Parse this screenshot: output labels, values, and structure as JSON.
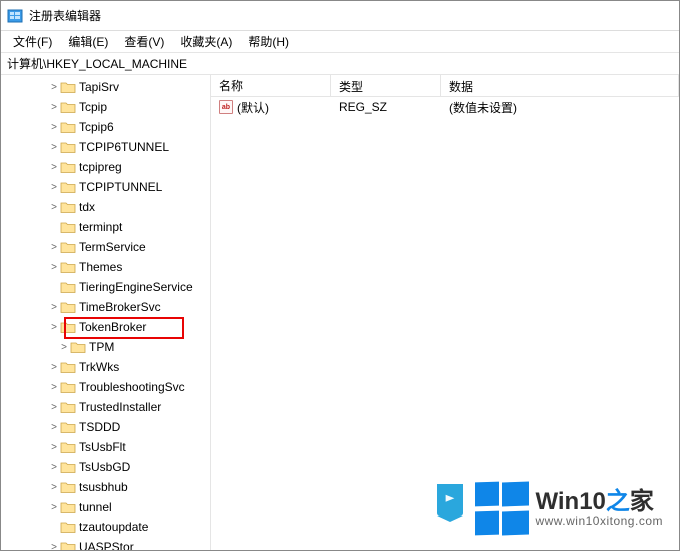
{
  "window": {
    "title": "注册表编辑器"
  },
  "menu": {
    "file": "文件(F)",
    "edit": "编辑(E)",
    "view": "查看(V)",
    "favorites": "收藏夹(A)",
    "help": "帮助(H)"
  },
  "address": {
    "path": "计算机\\HKEY_LOCAL_MACHINE"
  },
  "list": {
    "columns": {
      "name": "名称",
      "type": "类型",
      "data": "数据"
    },
    "rows": [
      {
        "name": "(默认)",
        "type": "REG_SZ",
        "data": "(数值未设置)"
      }
    ]
  },
  "tree": {
    "items": [
      {
        "label": "TapiSrv",
        "expander": ">",
        "indent": 1
      },
      {
        "label": "Tcpip",
        "expander": ">",
        "indent": 1
      },
      {
        "label": "Tcpip6",
        "expander": ">",
        "indent": 1
      },
      {
        "label": "TCPIP6TUNNEL",
        "expander": ">",
        "indent": 1
      },
      {
        "label": "tcpipreg",
        "expander": ">",
        "indent": 1
      },
      {
        "label": "TCPIPTUNNEL",
        "expander": ">",
        "indent": 1
      },
      {
        "label": "tdx",
        "expander": ">",
        "indent": 1
      },
      {
        "label": "terminpt",
        "expander": "",
        "indent": 1
      },
      {
        "label": "TermService",
        "expander": ">",
        "indent": 1
      },
      {
        "label": "Themes",
        "expander": ">",
        "indent": 1
      },
      {
        "label": "TieringEngineService",
        "expander": "",
        "indent": 1
      },
      {
        "label": "TimeBrokerSvc",
        "expander": ">",
        "indent": 1
      },
      {
        "label": "TokenBroker",
        "expander": ">",
        "indent": 1,
        "highlighted": true
      },
      {
        "label": "TPM",
        "expander": ">",
        "indent": 2
      },
      {
        "label": "TrkWks",
        "expander": ">",
        "indent": 1
      },
      {
        "label": "TroubleshootingSvc",
        "expander": ">",
        "indent": 1
      },
      {
        "label": "TrustedInstaller",
        "expander": ">",
        "indent": 1
      },
      {
        "label": "TSDDD",
        "expander": ">",
        "indent": 1
      },
      {
        "label": "TsUsbFlt",
        "expander": ">",
        "indent": 1
      },
      {
        "label": "TsUsbGD",
        "expander": ">",
        "indent": 1
      },
      {
        "label": "tsusbhub",
        "expander": ">",
        "indent": 1
      },
      {
        "label": "tunnel",
        "expander": ">",
        "indent": 1
      },
      {
        "label": "tzautoupdate",
        "expander": "",
        "indent": 1
      },
      {
        "label": "UASPStor",
        "expander": ">",
        "indent": 1
      }
    ]
  },
  "watermark": {
    "brand_prefix": "Win10",
    "brand_mid": "之",
    "brand_suffix": "家",
    "url": "www.win10xitong.com"
  },
  "icons": {
    "value_ab": "ab"
  }
}
